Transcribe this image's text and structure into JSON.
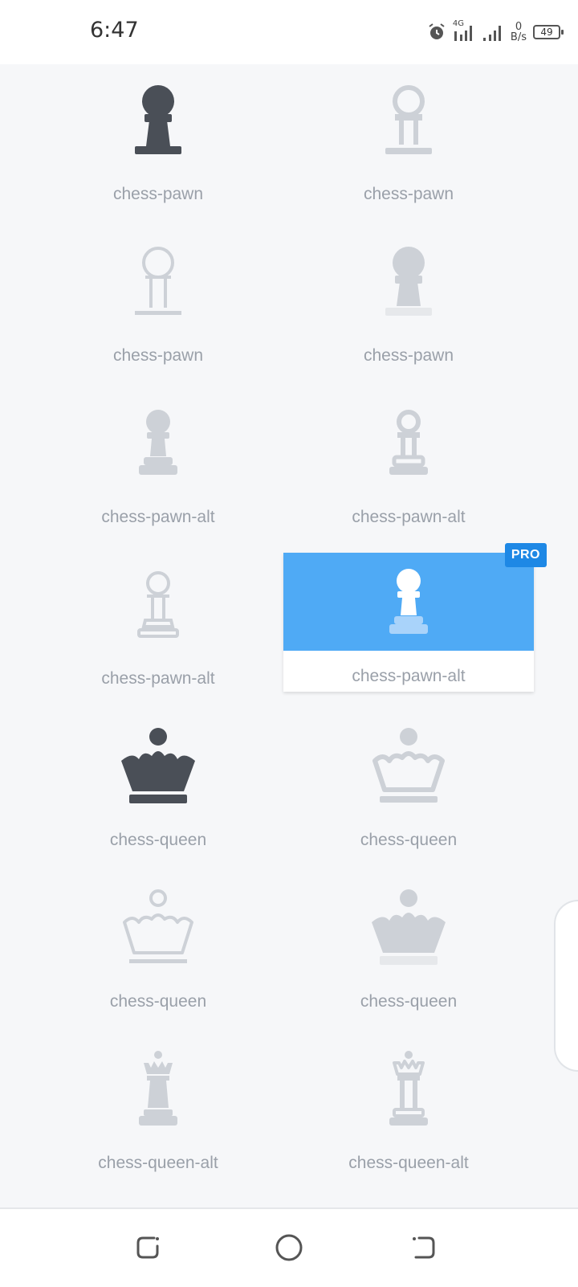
{
  "status": {
    "time": "6:47",
    "network_type": "4G",
    "speed_value": "0",
    "speed_unit": "B/s",
    "battery": "49"
  },
  "icons": [
    {
      "label": "chess-pawn",
      "icon": "chess-pawn-solid-icon",
      "tone": "dark"
    },
    {
      "label": "chess-pawn",
      "icon": "chess-pawn-outline-icon",
      "tone": "light"
    },
    {
      "label": "chess-pawn",
      "icon": "chess-pawn-thin-outline-icon",
      "tone": "light"
    },
    {
      "label": "chess-pawn",
      "icon": "chess-pawn-duotone-icon",
      "tone": "light"
    },
    {
      "label": "chess-pawn-alt",
      "icon": "chess-pawn-alt-solid-icon",
      "tone": "light"
    },
    {
      "label": "chess-pawn-alt",
      "icon": "chess-pawn-alt-outline-icon",
      "tone": "light"
    },
    {
      "label": "chess-pawn-alt",
      "icon": "chess-pawn-alt-thin-icon",
      "tone": "light"
    },
    {
      "label": "chess-pawn-alt",
      "icon": "chess-pawn-alt-duotone-icon",
      "tone": "white",
      "selected": true,
      "badge": "PRO"
    },
    {
      "label": "chess-queen",
      "icon": "chess-queen-solid-icon",
      "tone": "dark"
    },
    {
      "label": "chess-queen",
      "icon": "chess-queen-outline-icon",
      "tone": "light"
    },
    {
      "label": "chess-queen",
      "icon": "chess-queen-thin-icon",
      "tone": "light"
    },
    {
      "label": "chess-queen",
      "icon": "chess-queen-duotone-icon",
      "tone": "light"
    },
    {
      "label": "chess-queen-alt",
      "icon": "chess-queen-alt-solid-icon",
      "tone": "light"
    },
    {
      "label": "chess-queen-alt",
      "icon": "chess-queen-alt-outline-icon",
      "tone": "light"
    }
  ],
  "colors": {
    "dark": "#4a4f57",
    "light": "#cdd1d7",
    "lighter": "#e6e8eb",
    "selected_bg": "#4faaf5",
    "badge": "#1e88e5"
  }
}
